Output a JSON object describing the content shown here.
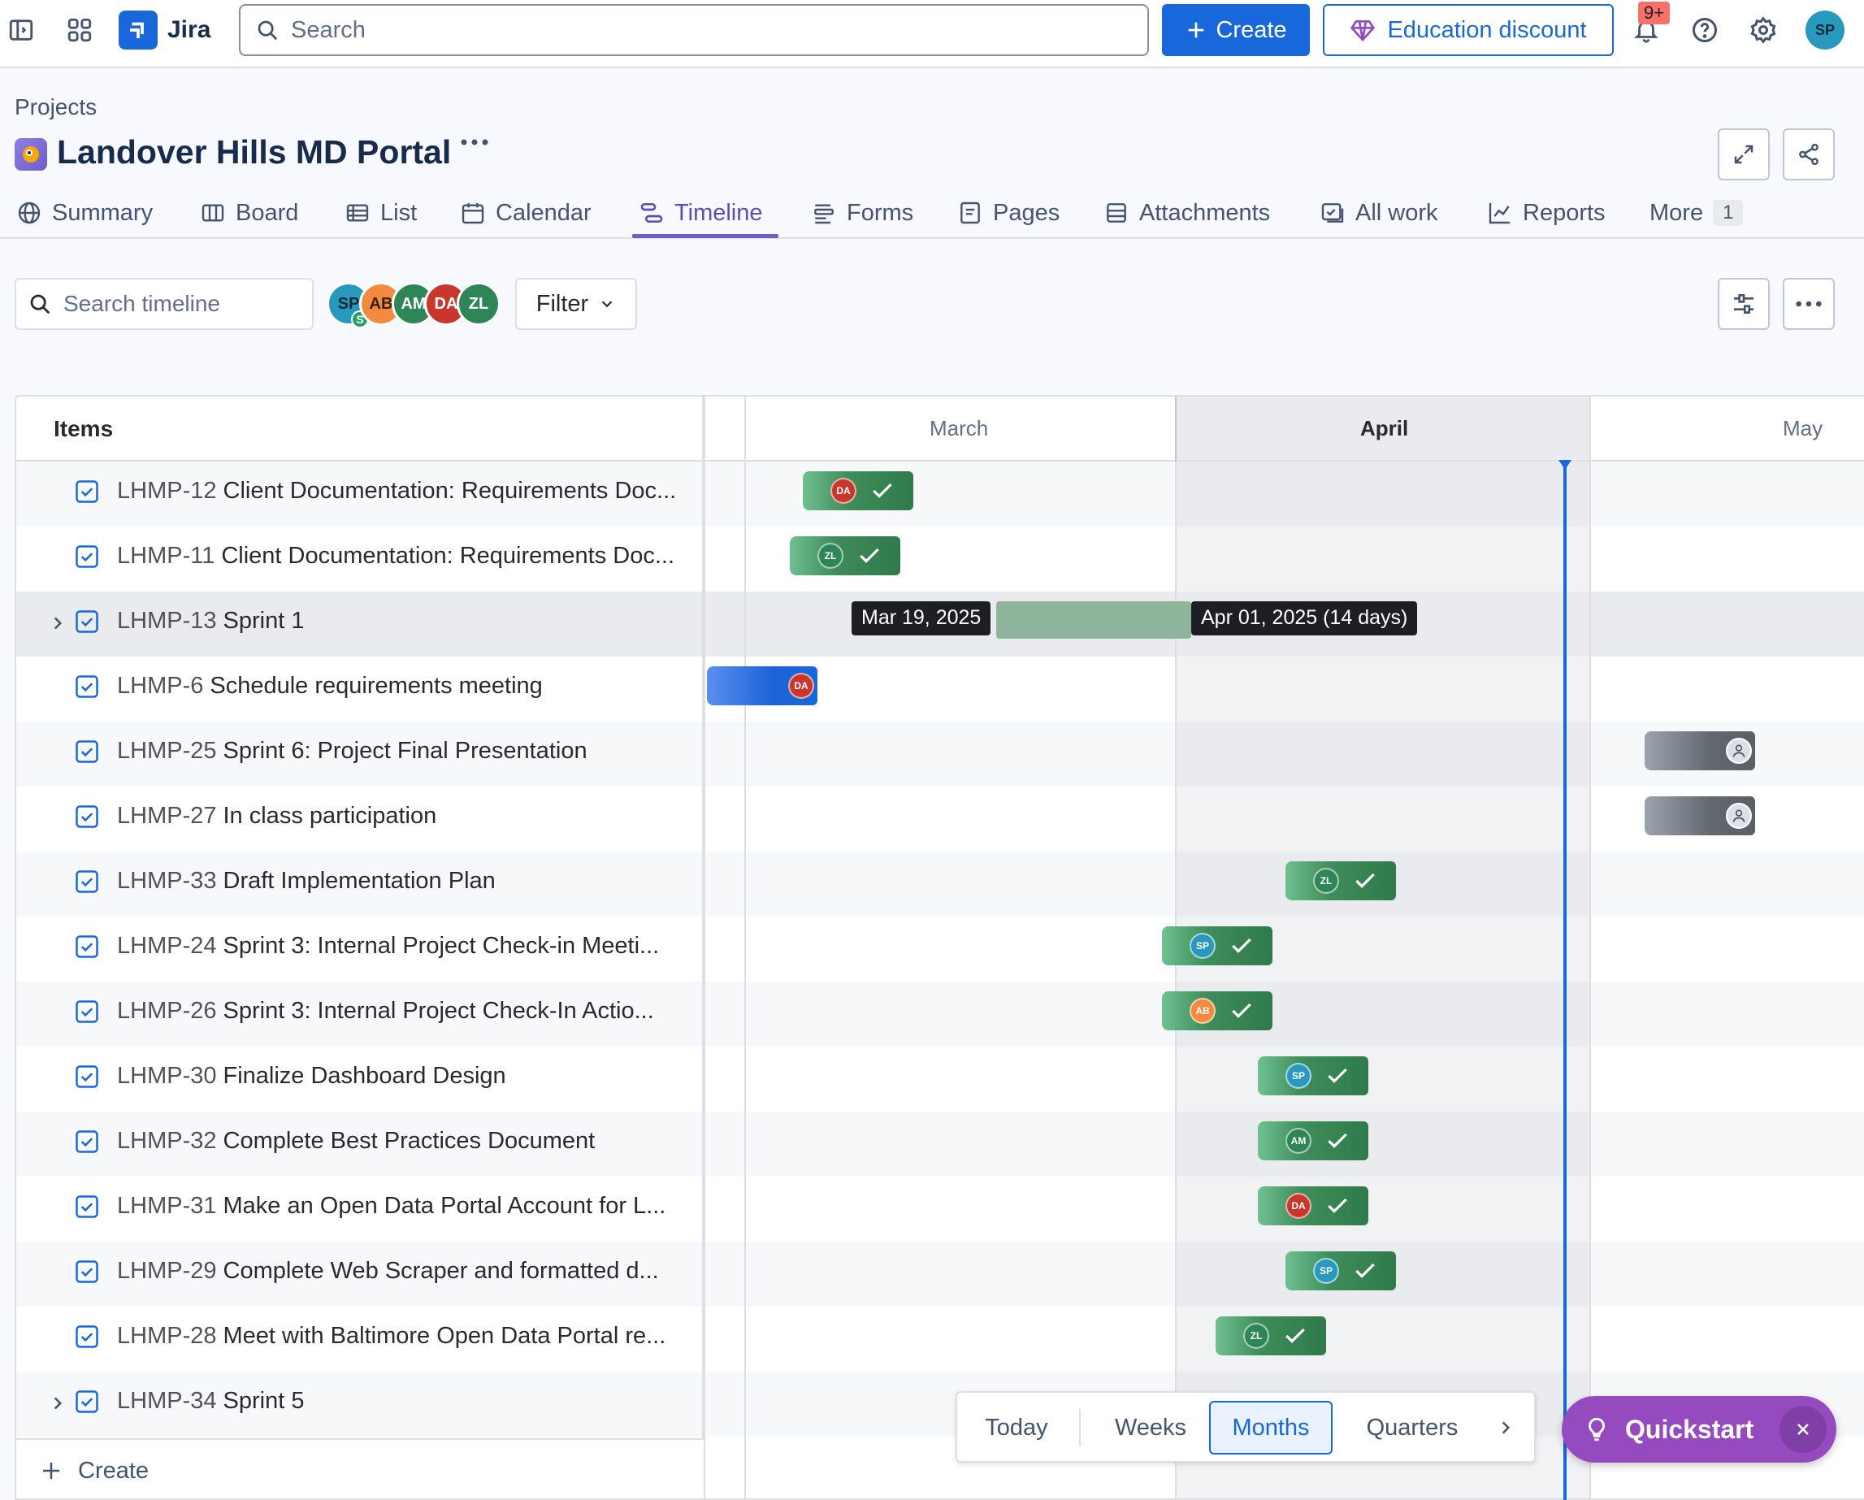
{
  "topnav": {
    "app_name": "Jira",
    "search_placeholder": "Search",
    "create_label": "Create",
    "education_label": "Education discount",
    "notif_badge": "9+",
    "user_initials": "SP"
  },
  "header": {
    "breadcrumb": "Projects",
    "title": "Landover Hills MD Portal"
  },
  "tabs": [
    {
      "label": "Summary"
    },
    {
      "label": "Board"
    },
    {
      "label": "List"
    },
    {
      "label": "Calendar"
    },
    {
      "label": "Timeline"
    },
    {
      "label": "Forms"
    },
    {
      "label": "Pages"
    },
    {
      "label": "Attachments"
    },
    {
      "label": "All work"
    },
    {
      "label": "Reports"
    },
    {
      "label": "More",
      "count": "1"
    }
  ],
  "toolbar": {
    "search_placeholder": "Search timeline",
    "filter_label": "Filter",
    "avatars": [
      "SP",
      "AB",
      "AM",
      "DA",
      "ZL"
    ]
  },
  "grid": {
    "items_header": "Items",
    "months": [
      "March",
      "April",
      "May"
    ],
    "rows": [
      {
        "key": "LHMP-12",
        "title": "Client Documentation: Requirements Doc...",
        "assignee": "DA",
        "status": "done"
      },
      {
        "key": "LHMP-11",
        "title": "Client Documentation: Requirements Doc...",
        "assignee": "ZL",
        "status": "done"
      },
      {
        "key": "LHMP-13",
        "title": "Sprint 1",
        "expandable": true,
        "start_tip": "Mar 19, 2025",
        "end_tip": "Apr 01, 2025 (14 days)"
      },
      {
        "key": "LHMP-6",
        "title": "Schedule requirements meeting",
        "assignee": "DA",
        "status": "in-progress"
      },
      {
        "key": "LHMP-25",
        "title": "Sprint 6: Project Final Presentation",
        "status": "todo"
      },
      {
        "key": "LHMP-27",
        "title": "In class participation",
        "status": "todo"
      },
      {
        "key": "LHMP-33",
        "title": "Draft Implementation Plan",
        "assignee": "ZL",
        "status": "done"
      },
      {
        "key": "LHMP-24",
        "title": "Sprint 3: Internal Project Check-in Meeti...",
        "assignee": "SP",
        "status": "done"
      },
      {
        "key": "LHMP-26",
        "title": "Sprint 3: Internal Project Check-In Actio...",
        "assignee": "AB",
        "status": "done"
      },
      {
        "key": "LHMP-30",
        "title": "Finalize Dashboard Design",
        "assignee": "SP",
        "status": "done"
      },
      {
        "key": "LHMP-32",
        "title": "Complete Best Practices Document",
        "assignee": "AM",
        "status": "done"
      },
      {
        "key": "LHMP-31",
        "title": "Make an Open Data Portal Account for L...",
        "assignee": "DA",
        "status": "done"
      },
      {
        "key": "LHMP-29",
        "title": "Complete Web Scraper and formatted d...",
        "assignee": "SP",
        "status": "done"
      },
      {
        "key": "LHMP-28",
        "title": "Meet with Baltimore Open Data Portal re...",
        "assignee": "ZL",
        "status": "done"
      },
      {
        "key": "LHMP-34",
        "title": "Sprint 5",
        "expandable": true
      }
    ],
    "create_label": "Create"
  },
  "view_switcher": {
    "options": [
      "Today",
      "Weeks",
      "Months",
      "Quarters"
    ],
    "selected": "Months"
  },
  "quickstart_label": "Quickstart",
  "colors": {
    "brand": "#1868db",
    "accent_purple": "#6e5dc6",
    "done_green": "#2f7a4b",
    "avatar_SP": "#2898bd",
    "avatar_AB": "#f38a3f",
    "avatar_AM": "#2e8555",
    "avatar_DA": "#c9372c",
    "avatar_ZL": "#2e8555"
  }
}
